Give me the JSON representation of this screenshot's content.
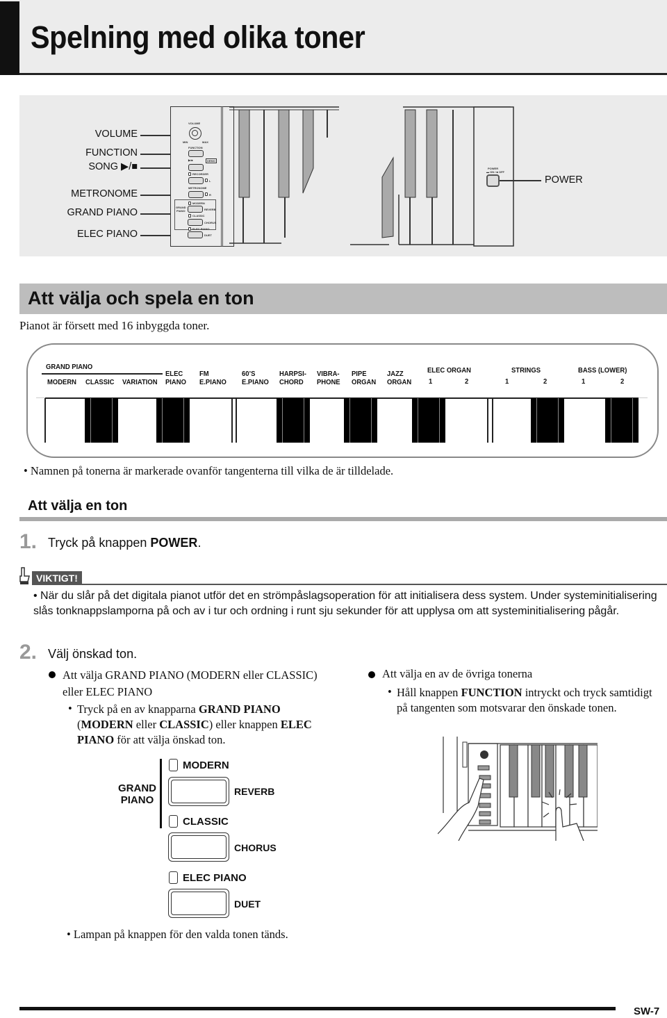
{
  "page_title": "Spelning med olika toner",
  "panel_illustration": {
    "labels": {
      "volume": "VOLUME",
      "function": "FUNCTION",
      "song": "SONG ▶/■",
      "metronome": "METRONOME",
      "grand_piano": "GRAND PIANO",
      "elec_piano": "ELEC PIANO",
      "power": "POWER"
    },
    "panel_tiny": {
      "volume": "VOLUME",
      "min": "MIN",
      "max": "MAX",
      "function": "FUNCTION",
      "song": "▶/■",
      "demo": "DEMO",
      "recorder": "RECORDER",
      "l": "L",
      "metronome": "METRONOME",
      "r": "R",
      "grand": "GRAND",
      "piano": "PIANO",
      "modern": "MODERN",
      "reverb": "REVERB",
      "classic": "CLASSIC",
      "chorus": "CHORUS",
      "elec_piano": "ELEC PIANO",
      "duet": "DUET",
      "power": "POWER",
      "power_onoff": "▬ ON / ■ OFF"
    }
  },
  "section": {
    "heading": "Att välja och spela en ton",
    "intro": "Pianot är försett med 16 inbyggda toner."
  },
  "tone_keyboard": {
    "group_grand_piano": "GRAND PIANO",
    "tones": [
      {
        "line1": "",
        "line2": "MODERN"
      },
      {
        "line1": "",
        "line2": "CLASSIC"
      },
      {
        "line1": "",
        "line2": "VARIATION"
      },
      {
        "line1": "ELEC",
        "line2": "PIANO"
      },
      {
        "line1": "FM",
        "line2": "E.PIANO"
      },
      {
        "line1": "60’S",
        "line2": "E.PIANO"
      },
      {
        "line1": "HARPSI-",
        "line2": "CHORD"
      },
      {
        "line1": "VIBRA-",
        "line2": "PHONE"
      },
      {
        "line1": "PIPE",
        "line2": "ORGAN"
      },
      {
        "line1": "JAZZ",
        "line2": "ORGAN"
      }
    ],
    "groups": [
      {
        "name": "ELEC ORGAN",
        "n1": "1",
        "n2": "2"
      },
      {
        "name": "STRINGS",
        "n1": "1",
        "n2": "2"
      },
      {
        "name": "BASS (LOWER)",
        "n1": "1",
        "n2": "2"
      }
    ]
  },
  "note_keys": "• Namnen på tonerna är markerade ovanför tangenterna till vilka de är tilldelade.",
  "sub_heading": "Att välja en ton",
  "step1": {
    "num": "1.",
    "text": "Tryck på knappen ",
    "bold": "POWER",
    "end": "."
  },
  "important": {
    "badge": "VIKTIGT!",
    "text": "•  När du slår på det digitala pianot utför det en strömpåslagsoperation för att initialisera dess system. Under systeminitialisering slås tonknappslamporna på och av i tur och ordning i runt sju sekunder för att upplysa om att systeminitialisering pågår."
  },
  "step2": {
    "num": "2.",
    "text": "Välj önskad ton."
  },
  "left_col": {
    "heading": "Att välja GRAND PIANO (MODERN eller CLASSIC) eller ELEC PIANO",
    "sub": {
      "t1": "Tryck på en av knapparna ",
      "b1": "GRAND PIANO",
      "t2": " (",
      "b2": "MODERN",
      "t3": " eller ",
      "b3": "CLASSIC",
      "t4": ") eller knappen ",
      "b4": "ELEC PIANO",
      "t5": " för att välja önskad ton."
    }
  },
  "right_col": {
    "heading": "Att välja en av de övriga tonerna",
    "sub": {
      "t1": "Håll knappen ",
      "b1": "FUNCTION",
      "t2": " intryckt och tryck samtidigt på tangenten som motsvarar den önskade tonen."
    }
  },
  "button_diagram": {
    "grand": "GRAND",
    "piano": "PIANO",
    "modern": "MODERN",
    "reverb": "REVERB",
    "classic": "CLASSIC",
    "chorus": "CHORUS",
    "elec_piano": "ELEC PIANO",
    "duet": "DUET"
  },
  "lamp_note": "•  Lampan på knappen för den valda tonen tänds.",
  "page_number": "SW-7"
}
